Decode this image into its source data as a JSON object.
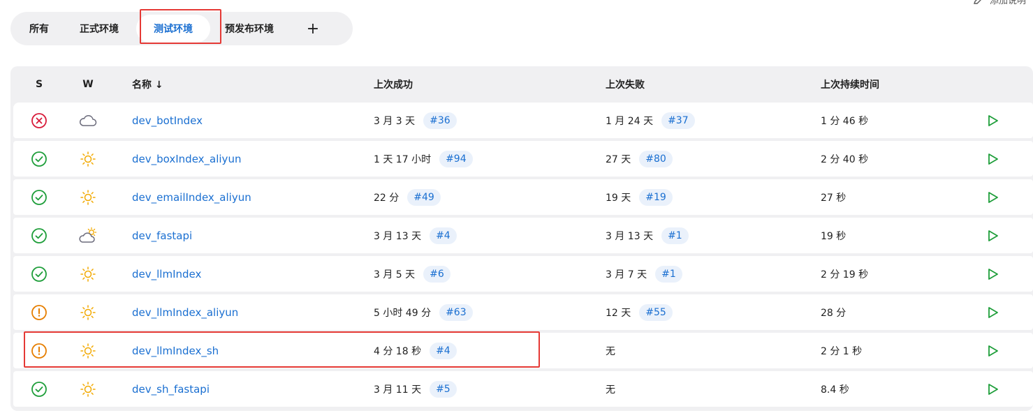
{
  "header": {
    "edit_label": "添加说明"
  },
  "tabs": [
    {
      "label": "所有"
    },
    {
      "label": "正式环境"
    },
    {
      "label": "测试环境",
      "active": true
    },
    {
      "label": "预发布环境"
    },
    {
      "label": "+"
    }
  ],
  "table": {
    "headers": {
      "s": "S",
      "w": "W",
      "name": "名称 ↓",
      "last_success": "上次成功",
      "last_failure": "上次失败",
      "last_duration": "上次持续时间"
    },
    "rows": [
      {
        "status": "failed",
        "weather": "cloudy",
        "name": "dev_botIndex",
        "last_success": "3 月 3 天",
        "success_build": "#36",
        "last_failure": "1 月 24 天",
        "failure_build": "#37",
        "duration": "1 分 46 秒"
      },
      {
        "status": "success",
        "weather": "sunny",
        "name": "dev_boxIndex_aliyun",
        "last_success": "1 天 17 小时",
        "success_build": "#94",
        "last_failure": "27 天",
        "failure_build": "#80",
        "duration": "2 分 40 秒"
      },
      {
        "status": "success",
        "weather": "sunny",
        "name": "dev_emailIndex_aliyun",
        "last_success": "22 分",
        "success_build": "#49",
        "last_failure": "19 天",
        "failure_build": "#19",
        "duration": "27 秒"
      },
      {
        "status": "success",
        "weather": "partly-cloudy",
        "name": "dev_fastapi",
        "last_success": "3 月 13 天",
        "success_build": "#4",
        "last_failure": "3 月 13 天",
        "failure_build": "#1",
        "duration": "19 秒"
      },
      {
        "status": "success",
        "weather": "sunny",
        "name": "dev_llmIndex",
        "last_success": "3 月 5 天",
        "success_build": "#6",
        "last_failure": "3 月 7 天",
        "failure_build": "#1",
        "duration": "2 分 19 秒"
      },
      {
        "status": "unstable",
        "weather": "sunny",
        "name": "dev_llmIndex_aliyun",
        "last_success": "5 小时 49 分",
        "success_build": "#63",
        "last_failure": "12 天",
        "failure_build": "#55",
        "duration": "28 分"
      },
      {
        "status": "unstable",
        "weather": "sunny",
        "name": "dev_llmIndex_sh",
        "last_success": "4 分 18 秒",
        "success_build": "#4",
        "last_failure": "无",
        "failure_build": "",
        "duration": "2 分 1 秒"
      },
      {
        "status": "success",
        "weather": "sunny",
        "name": "dev_sh_fastapi",
        "last_success": "3 月 11 天",
        "success_build": "#5",
        "last_failure": "无",
        "failure_build": "",
        "duration": "8.4 秒"
      }
    ]
  },
  "colors": {
    "accent": "#1a6fd1",
    "success": "#1e9e3a",
    "failed": "#d81b3a",
    "unstable": "#e67e00",
    "sun": "#f2a900",
    "cloud": "#6b6b7b",
    "highlight": "#e53935"
  }
}
